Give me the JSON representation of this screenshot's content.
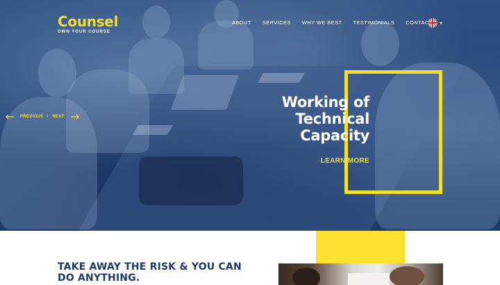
{
  "brand": {
    "name": "Counsel",
    "tagline": "OWN YOUR COURSE"
  },
  "nav": {
    "items": [
      {
        "label": "ABOUT"
      },
      {
        "label": "SERVICES"
      },
      {
        "label": "WHY WE BEST"
      },
      {
        "label": "TESTIMONIALS"
      },
      {
        "label": "CONTACT"
      }
    ],
    "language_icon": "uk-flag-icon"
  },
  "slider": {
    "prev_label": "PREVIOUS",
    "separator": "/",
    "next_label": "NEXT"
  },
  "hero": {
    "headline_lines": [
      "Working of",
      "Technical",
      "Capacity"
    ],
    "cta_label": "LEARN MORE"
  },
  "section": {
    "title_lines": [
      "TAKE AWAY THE RISK & YOU CAN",
      "DO ANYTHING."
    ]
  },
  "colors": {
    "accent": "#f6df2b",
    "navy": "#1d3a6a",
    "overlay": "#254577"
  }
}
